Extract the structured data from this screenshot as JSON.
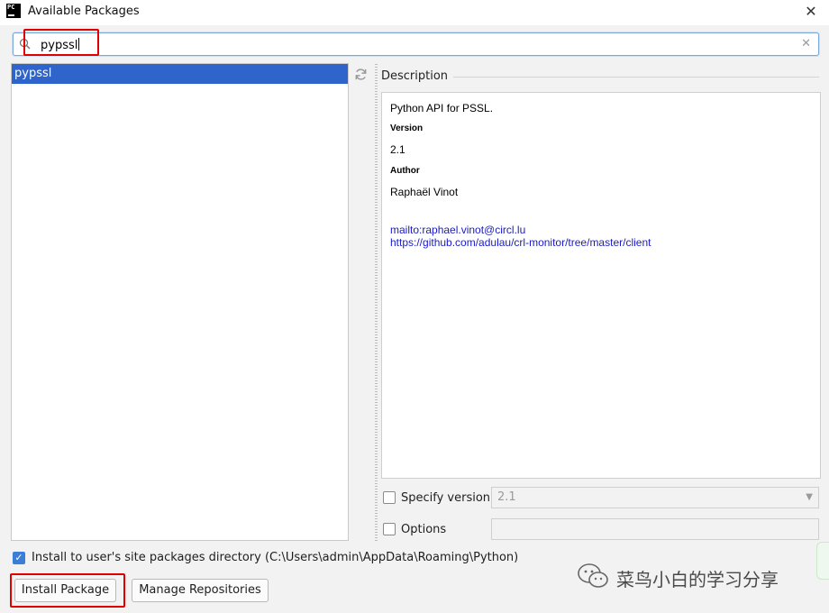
{
  "window": {
    "title": "Available Packages",
    "app_icon_text": "PC"
  },
  "search": {
    "value": "pypssl"
  },
  "packages": [
    {
      "name": "pypssl",
      "selected": true
    }
  ],
  "description": {
    "section_label": "Description",
    "summary": "Python API for PSSL.",
    "version_heading": "Version",
    "version": "2.1",
    "author_heading": "Author",
    "author": "Raphaël Vinot",
    "links": [
      "mailto:raphael.vinot@circl.lu",
      "https://github.com/adulau/crl-monitor/tree/master/client"
    ]
  },
  "options": {
    "specify_version_label": "Specify version",
    "specify_version_value": "2.1",
    "specify_version_checked": false,
    "options_label": "Options",
    "options_checked": false
  },
  "install_user": {
    "checked": true,
    "label": "Install to user's site packages directory (C:\\Users\\admin\\AppData\\Roaming\\Python)"
  },
  "buttons": {
    "install": "Install Package",
    "manage": "Manage Repositories"
  },
  "watermark": {
    "text": "菜鸟小白的学习分享"
  },
  "colors": {
    "selection": "#2f65ca",
    "highlight_box": "#e00000",
    "link": "#1a1acd",
    "checkbox": "#3a7ed8"
  }
}
